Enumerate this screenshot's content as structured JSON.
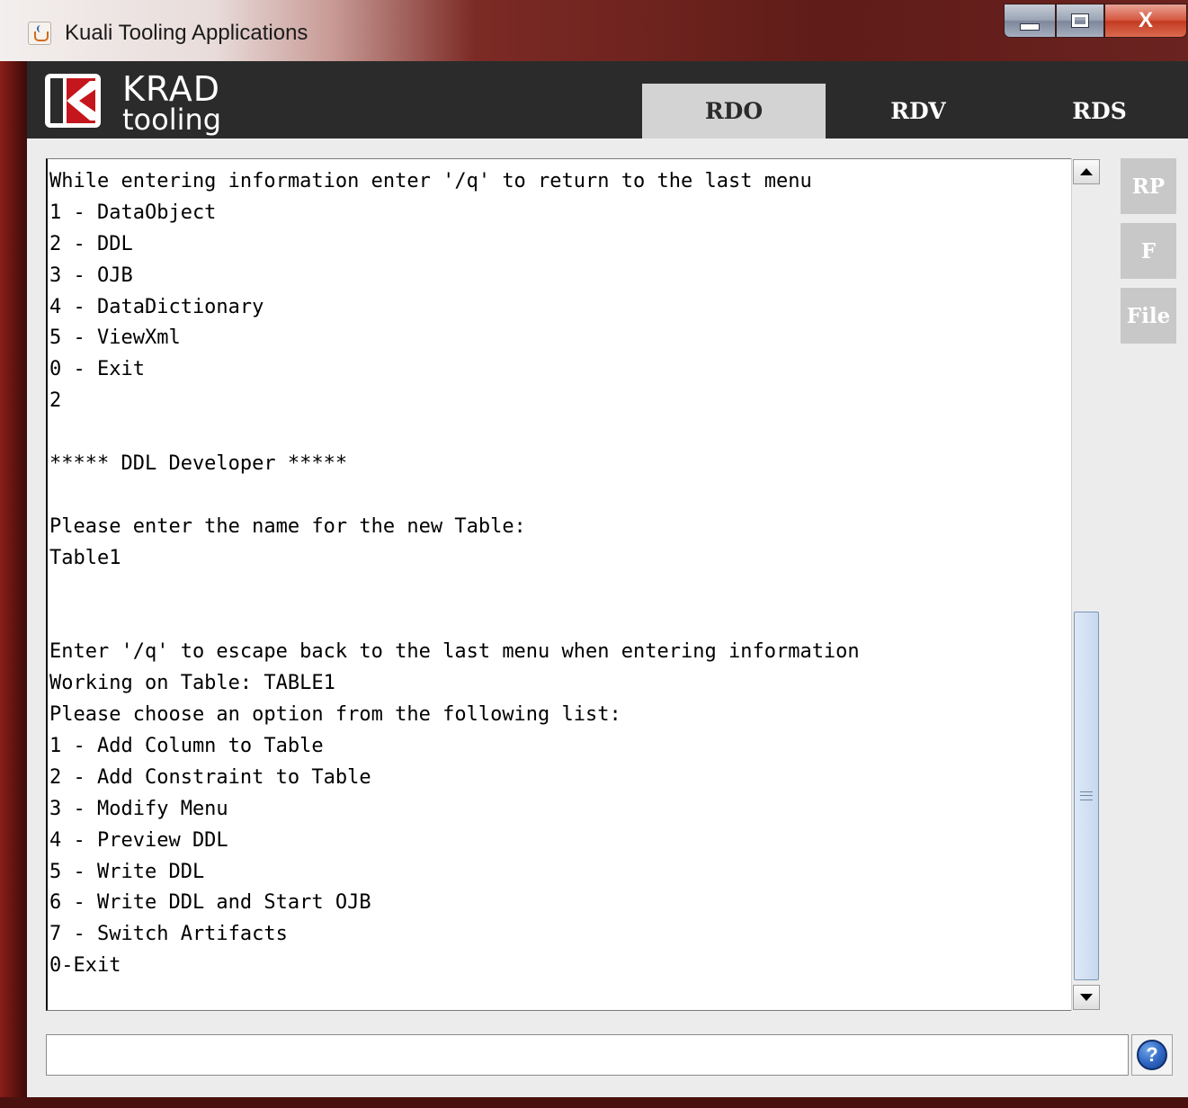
{
  "window": {
    "title": "Kuali Tooling Applications",
    "controls": {
      "minimize": "–",
      "maximize": "□",
      "close": "X"
    }
  },
  "header": {
    "logo_title": "KRAD",
    "logo_sub": "tooling",
    "tabs": [
      {
        "label": "RDO",
        "active": true
      },
      {
        "label": "RDV",
        "active": false
      },
      {
        "label": "RDS",
        "active": false
      }
    ]
  },
  "console": {
    "lines": [
      "While entering information enter '/q' to return to the last menu",
      "1 - DataObject",
      "2 - DDL",
      "3 - OJB",
      "4 - DataDictionary",
      "5 - ViewXml",
      "0 - Exit",
      "2",
      "",
      "***** DDL Developer *****",
      "",
      "Please enter the name for the new Table:",
      "Table1",
      "",
      "",
      "Enter '/q' to escape back to the last menu when entering information",
      "Working on Table: TABLE1",
      "Please choose an option from the following list:",
      "1 - Add Column to Table",
      "2 - Add Constraint to Table",
      "3 - Modify Menu",
      "4 - Preview DDL",
      "5 - Write DDL",
      "6 - Write DDL and Start OJB",
      "7 - Switch Artifacts",
      "0-Exit"
    ]
  },
  "side_buttons": [
    {
      "label": "RP"
    },
    {
      "label": "F"
    },
    {
      "label": "File"
    }
  ],
  "input": {
    "value": "",
    "placeholder": ""
  },
  "help": {
    "label": "?"
  },
  "colors": {
    "header_bg": "#2b2b2b",
    "active_tab": "#d3d3d3",
    "side_button": "#c8c8c8",
    "logo_red": "#c4161c"
  }
}
